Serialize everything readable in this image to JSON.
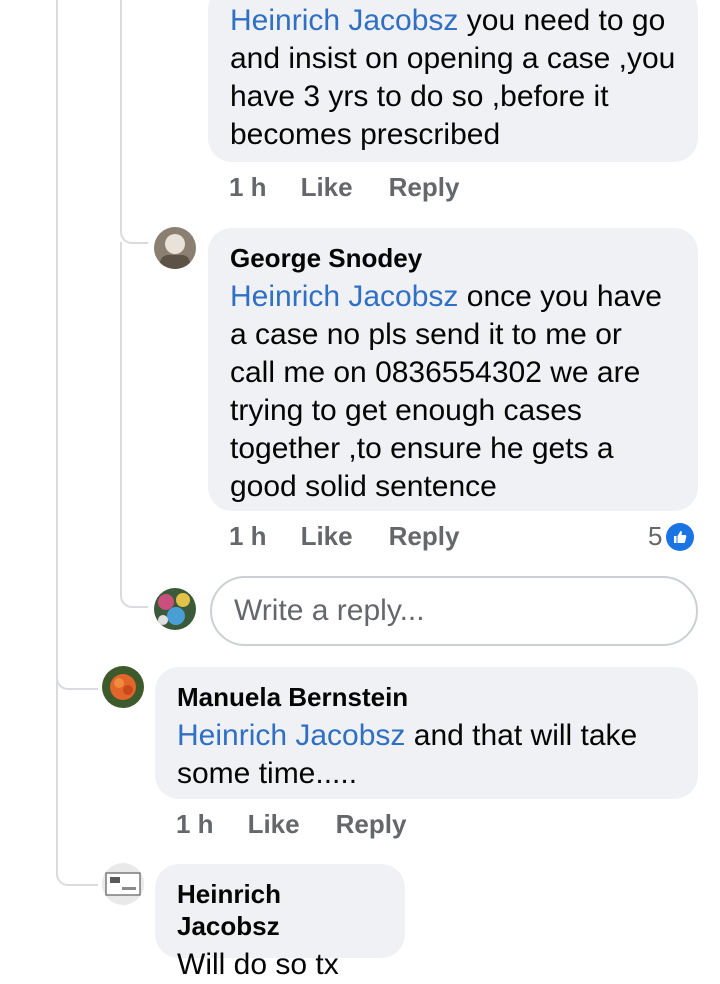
{
  "comments": [
    {
      "name": "",
      "mention": "Heinrich Jacobsz",
      "text_l1": " you need to go",
      "text_l2": "and insist on opening a case ,you",
      "text_l3": "have 3 yrs to do so ,before it",
      "text_l4": "becomes prescribed",
      "time": "1 h",
      "like_label": "Like",
      "reply_label": "Reply"
    },
    {
      "name": "George Snodey",
      "mention": "Heinrich Jacobsz",
      "text_l1": " once you have",
      "text_l2": "a case no pls send it to me or",
      "text_l3": "call me on 0836554302 we are",
      "text_l4": "trying to get enough cases",
      "text_l5": "together ,to ensure he gets a",
      "text_l6": "good solid sentence",
      "time": "1 h",
      "like_label": "Like",
      "reply_label": "Reply",
      "reaction_count": "5"
    },
    {
      "name": "Manuela Bernstein",
      "mention": "Heinrich Jacobsz",
      "text_l1": " and that will take",
      "text_l2": "some time.....",
      "time": "1 h",
      "like_label": "Like",
      "reply_label": "Reply"
    },
    {
      "name": "Heinrich Jacobsz",
      "text_l1": "Will do so tx"
    }
  ],
  "reply_box": {
    "placeholder": "Write a reply..."
  },
  "colors": {
    "mention": "#2f6fc4",
    "bubble": "#eff1f4",
    "like_badge": "#1b74e4",
    "secondary_text": "#65676b"
  },
  "icons": {
    "reaction": "like-thumb-icon"
  }
}
